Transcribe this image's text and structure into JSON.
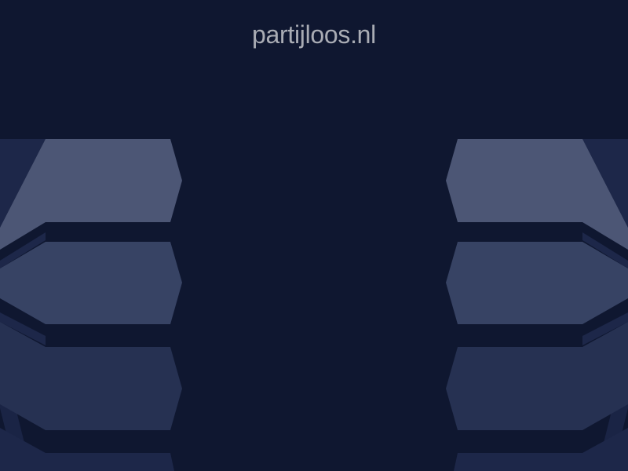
{
  "page": {
    "domain": "partijloos.nl"
  },
  "colors": {
    "background": "#0f1730",
    "title_text": "#a9acb4",
    "shade_1": "#4c5675",
    "shade_2": "#374364",
    "shade_3": "#263152",
    "shade_4": "#1d2749",
    "shade_5": "#1a2445"
  }
}
